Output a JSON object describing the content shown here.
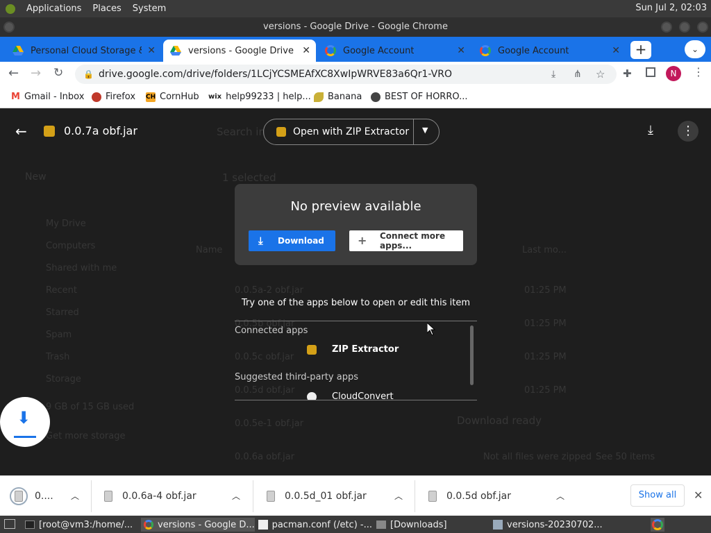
{
  "os_panel": {
    "menus": [
      "Applications",
      "Places",
      "System"
    ],
    "clock": "Sun Jul 2, 02:03"
  },
  "window": {
    "title": "versions - Google Drive - Google Chrome"
  },
  "tabs": [
    {
      "label": "Personal Cloud Storage & F",
      "active": false
    },
    {
      "label": "versions - Google Drive",
      "active": true
    },
    {
      "label": "Google Account",
      "active": false
    },
    {
      "label": "Google Account",
      "active": false
    }
  ],
  "address_bar": {
    "url": "drive.google.com/drive/folders/1LCjYCSMEAfXC8XwIpWRVE83a6Qr1-VRO"
  },
  "profile_initial": "N",
  "bookmarks": [
    {
      "label": "Gmail - Inbox",
      "icon": "gmail-icon",
      "color": "#ea4335"
    },
    {
      "label": "Firefox",
      "icon": "firefox-icon",
      "color": "#c0392b"
    },
    {
      "label": "CornHub",
      "icon": "ch-icon",
      "color": "#f5a623"
    },
    {
      "label": "help99233 | help...",
      "icon": "wix-icon",
      "color": "#222222"
    },
    {
      "label": "Banana",
      "icon": "banana-icon",
      "color": "#c9b037"
    },
    {
      "label": "BEST OF HORRO...",
      "icon": "globe-icon",
      "color": "#444444"
    }
  ],
  "viewer": {
    "file_name": "0.0.7a obf.jar",
    "open_with": "Open with ZIP Extractor"
  },
  "background_drive": {
    "search_placeholder": "Search in",
    "new_label": "New",
    "selected_label": "1 selected",
    "sidebar": [
      "My Drive",
      "Computers",
      "Shared with me",
      "Recent",
      "Starred",
      "Spam",
      "Trash",
      "Storage"
    ],
    "storage_text": "9 GB of 15 GB used",
    "storage_link": "Get more storage",
    "column_name": "Name",
    "column_modified": "Last mo...",
    "files": [
      {
        "name": "0.0.5a-2 obf.jar",
        "time": "01:25 PM"
      },
      {
        "name": "0.0.5b obf.jar",
        "time": "01:25 PM"
      },
      {
        "name": "0.0.5c obf.jar",
        "time": "01:25 PM"
      },
      {
        "name": "0.0.5d obf.jar",
        "time": "01:25 PM"
      },
      {
        "name": "0.0.5e-1 obf.jar",
        "time": ""
      },
      {
        "name": "0.0.6a obf.jar",
        "time": ""
      }
    ],
    "download_ready": "Download ready",
    "zipped_notice": "Not all files were zipped",
    "zipped_link": "See 50 items"
  },
  "dialog": {
    "title": "No preview available",
    "download": "Download",
    "connect": "Connect more apps..."
  },
  "apps": {
    "hint": "Try one of the apps below to open or edit this item",
    "connected_header": "Connected apps",
    "connected": [
      "ZIP Extractor"
    ],
    "suggested_header": "Suggested third-party apps",
    "suggested": [
      "CloudConvert"
    ]
  },
  "downloads": {
    "items": [
      "0....",
      "0.0.6a-4 obf.jar",
      "0.0.5d_01 obf.jar",
      "0.0.5d obf.jar"
    ],
    "show_all": "Show all"
  },
  "taskbar": [
    {
      "label": "[root@vm3:/home/...",
      "active": false
    },
    {
      "label": "versions - Google D...",
      "active": true
    },
    {
      "label": "pacman.conf (/etc) -...",
      "active": false
    },
    {
      "label": "[Downloads]",
      "active": false
    },
    {
      "label": "versions-20230702...",
      "active": false
    }
  ],
  "colors": {
    "chrome_blue": "#1a73e8",
    "viewer_bg": "#1e1e1e",
    "dialog_bg": "#3c3c3c"
  }
}
